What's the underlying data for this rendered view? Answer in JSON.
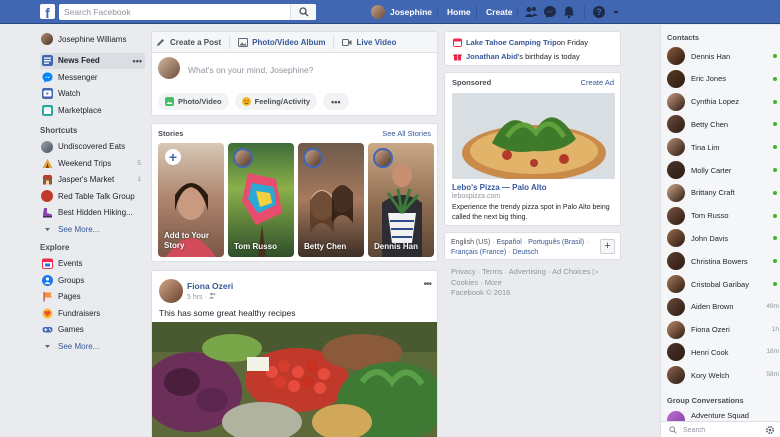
{
  "topbar": {
    "logo": "f",
    "search_placeholder": "Search Facebook",
    "user_name": "Josephine",
    "home": "Home",
    "create": "Create"
  },
  "left_nav": {
    "profile_name": "Josephine Williams",
    "items": [
      {
        "label": "News Feed",
        "icon": "news-feed-icon",
        "color": "#4267b2",
        "more": "•••"
      },
      {
        "label": "Messenger",
        "icon": "messenger-icon",
        "color": "#0084ff"
      },
      {
        "label": "Watch",
        "icon": "watch-icon",
        "color": "#4267b2"
      },
      {
        "label": "Marketplace",
        "icon": "marketplace-icon",
        "color": "#2aa5a0"
      }
    ],
    "shortcuts_title": "Shortcuts",
    "shortcuts": [
      {
        "label": "Undiscovered Eats",
        "count": ""
      },
      {
        "label": "Weekend Trips",
        "count": "5"
      },
      {
        "label": "Jasper's Market",
        "count": "1"
      },
      {
        "label": "Red Table Talk Group",
        "count": ""
      },
      {
        "label": "Best Hidden Hiking...",
        "count": ""
      }
    ],
    "see_more_1": "See More...",
    "explore_title": "Explore",
    "explore": [
      {
        "label": "Events",
        "icon": "events-icon",
        "color": "#f02849"
      },
      {
        "label": "Groups",
        "icon": "groups-icon",
        "color": "#1877f2"
      },
      {
        "label": "Pages",
        "icon": "pages-icon",
        "color": "#f7923b"
      },
      {
        "label": "Fundraisers",
        "icon": "fundraisers-icon",
        "color": "#f7b928"
      },
      {
        "label": "Games",
        "icon": "games-icon",
        "color": "#4267b2"
      }
    ],
    "see_more_2": "See More..."
  },
  "composer": {
    "tab_create": "Create a Post",
    "tab_photo_album": "Photo/Video Album",
    "tab_live": "Live Video",
    "placeholder": "What's on your mind, Josephine?",
    "btn_photo": "Photo/Video",
    "btn_feeling": "Feeling/Activity",
    "btn_more": "•••"
  },
  "stories": {
    "title": "Stories",
    "see_all": "See All Stories",
    "add_label": "Add to Your Story",
    "items": [
      {
        "name": "Tom Russo"
      },
      {
        "name": "Betty Chen"
      },
      {
        "name": "Dennis Han"
      }
    ]
  },
  "post": {
    "author": "Fiona Ozeri",
    "time": "5 hrs",
    "text": "This has some great healthy recipes",
    "more": "•••"
  },
  "events": {
    "trip_link": "Lake Tahoe Camping Trip",
    "trip_suffix": " on Friday",
    "bday_link": "Jonathan Abid",
    "bday_suffix": "'s birthday is today"
  },
  "sponsored": {
    "title": "Sponsored",
    "create_ad": "Create Ad",
    "ad_name": "Lebo's Pizza — Palo Alto",
    "ad_url": "lebospizza.com",
    "ad_desc": "Experience the trendy pizza spot in Palo Alto being called the next big thing."
  },
  "languages": {
    "current": "English (US)",
    "others": [
      "Español",
      "Português (Brasil)",
      "Français (France)",
      "Deutsch"
    ],
    "plus": "+"
  },
  "footer": {
    "line1": "Privacy · Terms · Advertising · Ad Choices ▷",
    "line2": "Cookies · More",
    "line3": "Facebook © 2016"
  },
  "contacts": {
    "title": "Contacts",
    "items": [
      {
        "name": "Dennis Han",
        "status": "online",
        "ago": ""
      },
      {
        "name": "Eric Jones",
        "status": "online",
        "ago": ""
      },
      {
        "name": "Cynthia Lopez",
        "status": "online",
        "ago": ""
      },
      {
        "name": "Betty Chen",
        "status": "online",
        "ago": ""
      },
      {
        "name": "Tina Lim",
        "status": "online",
        "ago": ""
      },
      {
        "name": "Molly Carter",
        "status": "online",
        "ago": ""
      },
      {
        "name": "Brittany Craft",
        "status": "online",
        "ago": ""
      },
      {
        "name": "Tom Russo",
        "status": "online",
        "ago": ""
      },
      {
        "name": "John Davis",
        "status": "online",
        "ago": ""
      },
      {
        "name": "Christina Bowers",
        "status": "online",
        "ago": ""
      },
      {
        "name": "Cristobal Garibay",
        "status": "online",
        "ago": ""
      },
      {
        "name": "Aiden Brown",
        "status": "away",
        "ago": "49m"
      },
      {
        "name": "Fiona Ozeri",
        "status": "away",
        "ago": "1h"
      },
      {
        "name": "Henri Cook",
        "status": "away",
        "ago": "18m"
      },
      {
        "name": "Kory Welch",
        "status": "away",
        "ago": "58m"
      }
    ],
    "group_title": "Group Conversations",
    "group_item": "Adventure Squad",
    "search_placeholder": "Search"
  },
  "colors": {
    "brand": "#4267b2",
    "link": "#365899",
    "online": "#42b72a"
  }
}
